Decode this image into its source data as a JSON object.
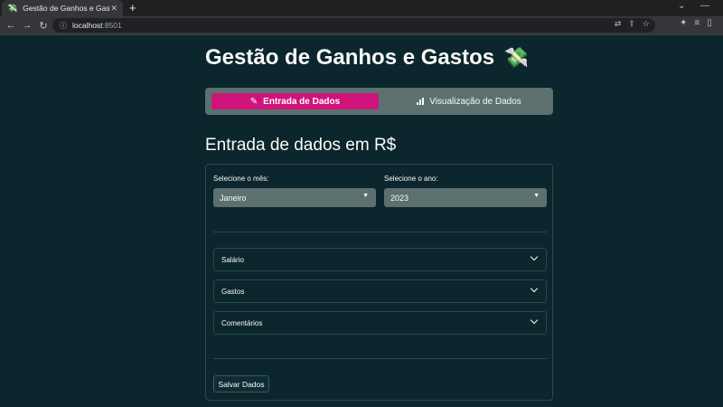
{
  "browser": {
    "tab_title": "Gestão de Ganhos e Gastos",
    "tab_favicon": "💸",
    "new_tab": "+",
    "url_host": "localhost",
    "url_port": ":8501",
    "info_icon": "ⓘ"
  },
  "page": {
    "title": "Gestão de Ganhos e Gastos",
    "title_emoji": "💸"
  },
  "tabs": [
    {
      "label": "Entrada de Dados",
      "icon": "pencil-icon",
      "active": true
    },
    {
      "label": "Visualização de Dados",
      "icon": "bar-chart-icon",
      "active": false
    }
  ],
  "section": {
    "title": "Entrada de dados em R$"
  },
  "form": {
    "month_label": "Selecione o mês:",
    "month_value": "Janeiro",
    "year_label": "Selecione o ano:",
    "year_value": "2023",
    "expanders": [
      {
        "label": "Salário"
      },
      {
        "label": "Gastos"
      },
      {
        "label": "Comentários"
      }
    ],
    "save_label": "Salvar Dados"
  },
  "colors": {
    "background": "#0b262c",
    "accent": "#d0137a",
    "secondary": "#5c7070"
  }
}
